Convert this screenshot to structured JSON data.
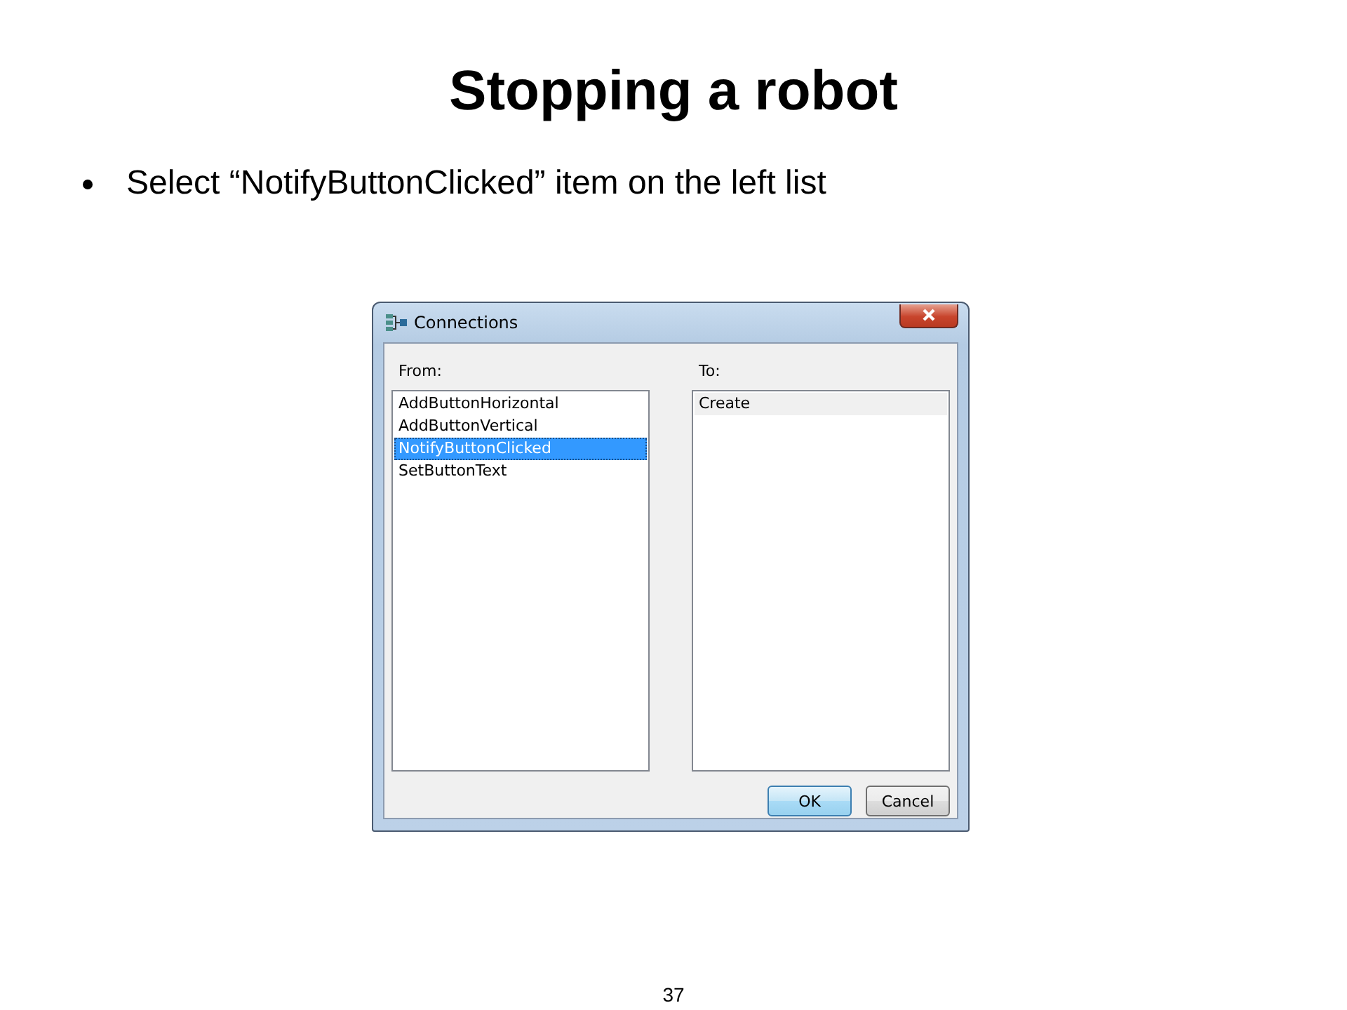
{
  "slide": {
    "title": "Stopping a robot",
    "bullets": [
      "Select “NotifyButtonClicked” item on the left list"
    ],
    "page_number": "37"
  },
  "dialog": {
    "title": "Connections",
    "lists": [
      {
        "label": "From:",
        "focused": true,
        "items": [
          {
            "text": "AddButtonHorizontal",
            "selected": false
          },
          {
            "text": "AddButtonVertical",
            "selected": false
          },
          {
            "text": "NotifyButtonClicked",
            "selected": true
          },
          {
            "text": "SetButtonText",
            "selected": false
          }
        ]
      },
      {
        "label": "To:",
        "focused": false,
        "items": [
          {
            "text": "Create",
            "selected": true
          }
        ]
      }
    ],
    "buttons": [
      {
        "label": "OK",
        "default": true
      },
      {
        "label": "Cancel",
        "default": false
      }
    ]
  }
}
